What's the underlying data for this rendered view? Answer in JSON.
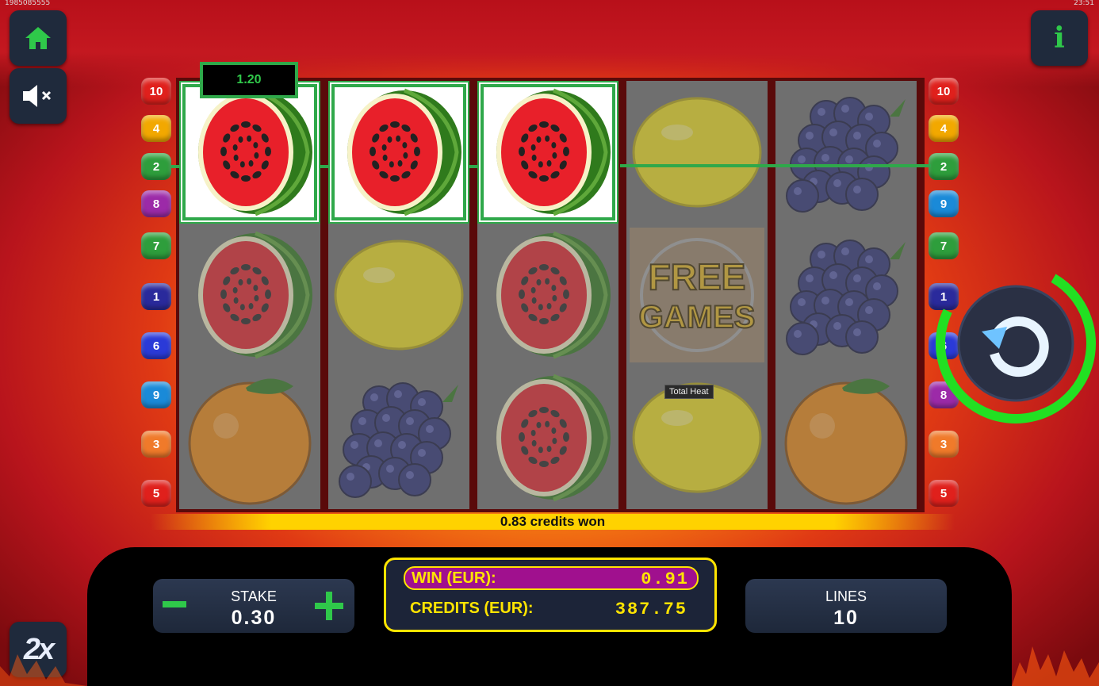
{
  "status_bar": {
    "left": "1985085555",
    "right": "23:51"
  },
  "buttons": {
    "home": "home-icon",
    "sound": "sound-muted-icon",
    "info": "i",
    "speed": "2x"
  },
  "paylines_left": [
    {
      "num": "10",
      "color": "#e0201c"
    },
    {
      "num": "4",
      "color": "#f2a800"
    },
    {
      "num": "2",
      "color": "#2e9e3c"
    },
    {
      "num": "8",
      "color": "#9c2aa8"
    },
    {
      "num": "7",
      "color": "#2e9e3c"
    },
    {
      "num": "1",
      "color": "#2a2a9c"
    },
    {
      "num": "6",
      "color": "#2a3ad8"
    },
    {
      "num": "9",
      "color": "#1a8ad8"
    },
    {
      "num": "3",
      "color": "#f07a2a"
    },
    {
      "num": "5",
      "color": "#e0201c"
    }
  ],
  "paylines_right": [
    {
      "num": "10",
      "color": "#e0201c"
    },
    {
      "num": "4",
      "color": "#f2a800"
    },
    {
      "num": "2",
      "color": "#2e9e3c"
    },
    {
      "num": "9",
      "color": "#1a8ad8"
    },
    {
      "num": "7",
      "color": "#2e9e3c"
    },
    {
      "num": "1",
      "color": "#2a2a9c"
    },
    {
      "num": "6",
      "color": "#2a3ad8"
    },
    {
      "num": "8",
      "color": "#9c2aa8"
    },
    {
      "num": "3",
      "color": "#f07a2a"
    },
    {
      "num": "5",
      "color": "#e0201c"
    }
  ],
  "reels": [
    [
      "watermelon",
      "watermelon",
      "orange"
    ],
    [
      "watermelon",
      "lemon",
      "grapes"
    ],
    [
      "watermelon",
      "watermelon",
      "watermelon"
    ],
    [
      "lemon",
      "free-games",
      "lemon"
    ],
    [
      "grapes",
      "grapes",
      "orange"
    ]
  ],
  "winning_cells": [
    [
      0,
      0
    ],
    [
      1,
      0
    ],
    [
      2,
      0
    ]
  ],
  "line_win": "1.20",
  "free_games_text": {
    "line1": "FREE",
    "line2": "GAMES"
  },
  "tooltip": "Total Heat",
  "message": "0.83 credits won",
  "stake": {
    "label": "STAKE",
    "value": "0.30",
    "minus": "−",
    "plus": "+"
  },
  "win": {
    "label": "WIN (EUR):",
    "value": "0.91"
  },
  "credits": {
    "label": "CREDITS (EUR):",
    "value": "387.75"
  },
  "lines": {
    "label": "LINES",
    "value": "10"
  },
  "colors": {
    "accent_green": "#2fa84a",
    "yellow": "#ffe400",
    "panel": "#1f2a3c"
  }
}
